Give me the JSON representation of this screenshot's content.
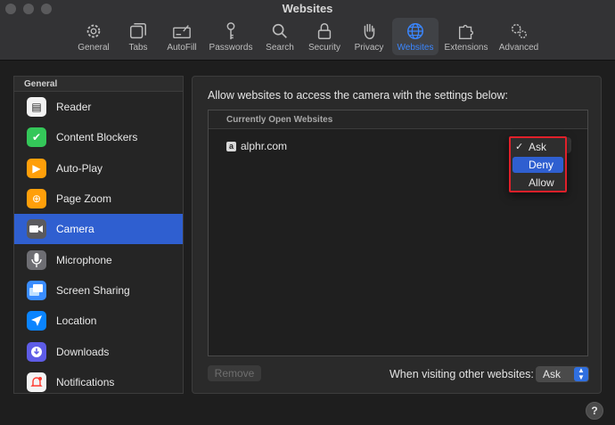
{
  "window": {
    "title": "Websites"
  },
  "toolbar": {
    "items": [
      {
        "label": "General",
        "icon": "gear-icon"
      },
      {
        "label": "Tabs",
        "icon": "tabs-icon"
      },
      {
        "label": "AutoFill",
        "icon": "autofill-icon"
      },
      {
        "label": "Passwords",
        "icon": "key-icon"
      },
      {
        "label": "Search",
        "icon": "search-icon"
      },
      {
        "label": "Security",
        "icon": "lock-icon"
      },
      {
        "label": "Privacy",
        "icon": "hand-icon"
      },
      {
        "label": "Websites",
        "icon": "globe-icon",
        "selected": true
      },
      {
        "label": "Extensions",
        "icon": "puzzle-icon"
      },
      {
        "label": "Advanced",
        "icon": "gears-icon"
      }
    ]
  },
  "sidebar": {
    "header": "General",
    "items": [
      {
        "label": "Reader",
        "icon": "reader-icon",
        "color": "#f2f2f2"
      },
      {
        "label": "Content Blockers",
        "icon": "content-blocker-icon",
        "color": "#34c759"
      },
      {
        "label": "Auto-Play",
        "icon": "play-icon",
        "color": "#ff9f0a"
      },
      {
        "label": "Page Zoom",
        "icon": "zoom-icon",
        "color": "#ff9f0a"
      },
      {
        "label": "Camera",
        "icon": "camera-icon",
        "color": "#5a5a5e",
        "selected": true
      },
      {
        "label": "Microphone",
        "icon": "microphone-icon",
        "color": "#6e6e73"
      },
      {
        "label": "Screen Sharing",
        "icon": "screen-sharing-icon",
        "color": "#3a8dff"
      },
      {
        "label": "Location",
        "icon": "location-icon",
        "color": "#0a84ff"
      },
      {
        "label": "Downloads",
        "icon": "downloads-icon",
        "color": "#5e5ce6"
      },
      {
        "label": "Notifications",
        "icon": "notifications-icon",
        "color": "#ff3b30"
      }
    ]
  },
  "main": {
    "description": "Allow websites to access the camera with the settings below:",
    "table_header": "Currently Open Websites",
    "sites": [
      {
        "name": "alphr.com",
        "icon_letter": "a"
      }
    ],
    "popup": {
      "options": [
        "Ask",
        "Deny",
        "Allow"
      ],
      "checked": "Ask",
      "highlighted": "Deny",
      "check_mark": "✓"
    },
    "remove_label": "Remove",
    "other_label": "When visiting other websites:",
    "other_value": "Ask",
    "help_label": "?"
  },
  "colors": {
    "accent": "#2f5fd0",
    "highlight_border": "#e0202a"
  }
}
